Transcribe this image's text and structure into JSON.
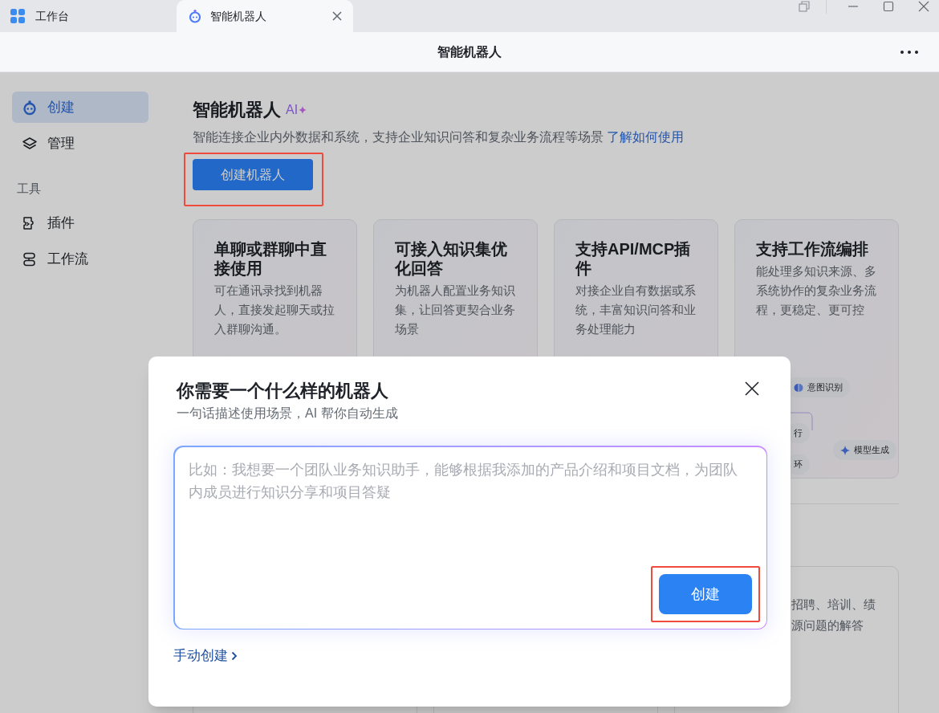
{
  "tabs": [
    {
      "label": "工作台",
      "selected": false
    },
    {
      "label": "智能机器人",
      "selected": true
    }
  ],
  "header": {
    "title": "智能机器人"
  },
  "sidebar": {
    "items": [
      {
        "label": "创建",
        "selected": true
      },
      {
        "label": "管理",
        "selected": false
      }
    ],
    "section_title": "工具",
    "tools": [
      {
        "label": "插件",
        "selected": false
      },
      {
        "label": "工作流",
        "selected": false
      }
    ]
  },
  "intro": {
    "title": "智能机器人",
    "badge": "AI",
    "description": "智能连接企业内外数据和系统，支持企业知识问答和复杂业务流程等场景",
    "link": "了解如何使用",
    "button": "创建机器人"
  },
  "features": [
    {
      "title": "单聊或群聊中直接使用",
      "description": "可在通讯录找到机器人，直接发起聊天或拉入群聊沟通。"
    },
    {
      "title": "可接入知识集优化回答",
      "description": "为机器人配置业务知识集，让回答更契合业务场景"
    },
    {
      "title": "支持API/MCP插件",
      "description": "对接企业自有数据或系统，丰富知识问答和业务处理能力"
    },
    {
      "title": "支持工作流编排",
      "description": "能处理多知识来源、多系统协作的复杂业务流程，更稳定、更可控",
      "diagram_nodes": [
        "意图识别",
        "行",
        "模型生成",
        "环"
      ]
    }
  ],
  "lower_card": {
    "lines": [
      "招聘、培训、绩",
      "源问题的解答"
    ]
  },
  "dialog": {
    "title": "你需要一个什么样的机器人",
    "subtitle": "一句话描述使用场景，AI 帮你自动生成",
    "placeholder": "比如：我想要一个团队业务知识助手，能够根据我添加的产品介绍和项目文档，为团队内成员进行知识分享和项目答疑",
    "submit": "创建",
    "manual_link": "手动创建"
  }
}
